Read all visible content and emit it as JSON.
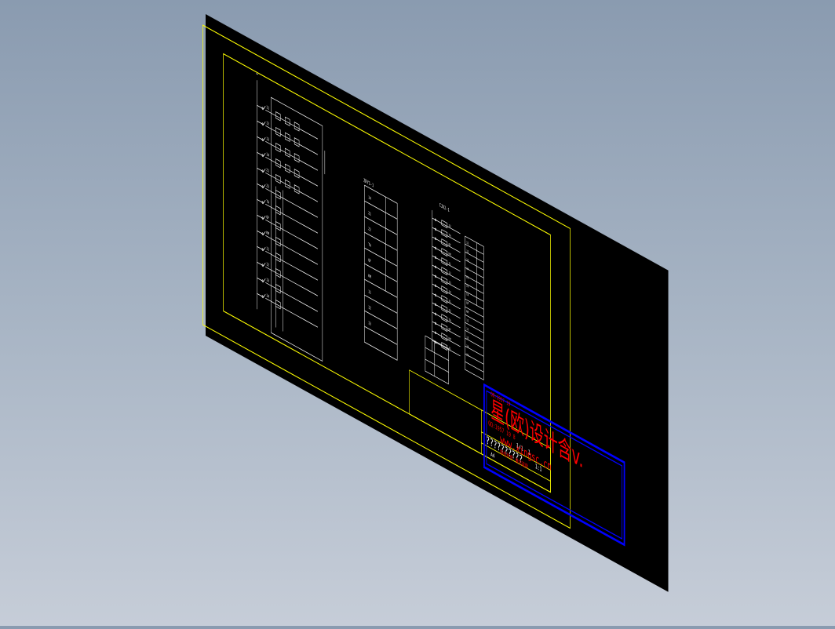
{
  "viewport": {
    "background_top": "#8a9bb0",
    "background_bottom": "#c6cdd8"
  },
  "colors": {
    "sheet": "#000000",
    "frame": "#ffff00",
    "lines": "#ffffff",
    "watermark_box": "#0000ff",
    "watermark_text": "#ff0000"
  },
  "watermark": {
    "line1": "星(欧)设计含v.",
    "line2": "www.xingsc.cn",
    "line3": "QQ:1957 19",
    "line4": "QQ:1957 19 8",
    "line5": "版权所有 请勿盗用"
  },
  "title_block": {
    "drawing_name": "??????????",
    "cells": [
      "1/1",
      "1",
      "1:1"
    ],
    "sheet_no": "A4"
  },
  "labels": {
    "tables_header_left": "ZRY1-1",
    "tables_header_right": "CJX2-1",
    "misc": [
      "11",
      "12",
      "13",
      "14",
      "21",
      "22",
      "TA",
      "QF",
      "KM"
    ]
  }
}
